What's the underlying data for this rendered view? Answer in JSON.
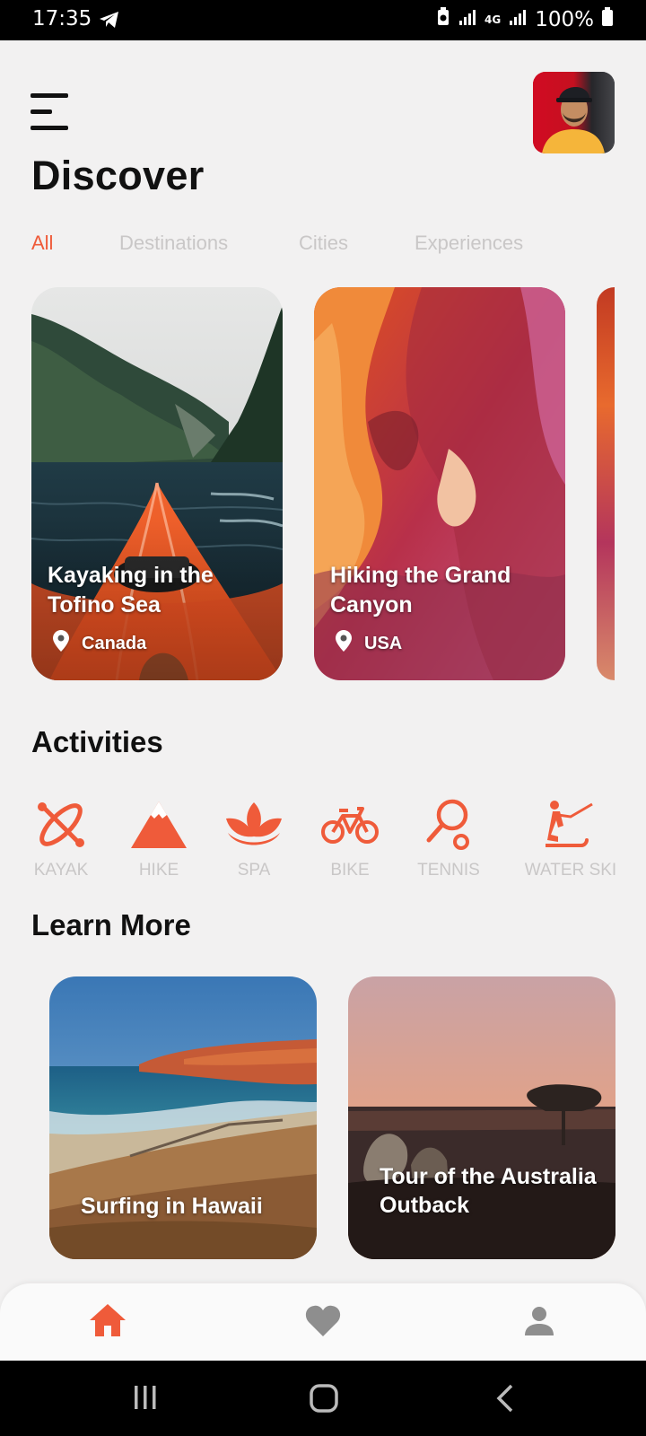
{
  "status_bar": {
    "time": "17:35",
    "battery": "100%",
    "network": "4G"
  },
  "header": {
    "title": "Discover"
  },
  "tabs": [
    {
      "label": "All",
      "active": true
    },
    {
      "label": "Destinations",
      "active": false
    },
    {
      "label": "Cities",
      "active": false
    },
    {
      "label": "Experiences",
      "active": false
    }
  ],
  "destinations": [
    {
      "title": "Kayaking in the Tofino Sea",
      "location": "Canada"
    },
    {
      "title": "Hiking the Grand Canyon",
      "location": "USA"
    }
  ],
  "activities_section": {
    "title": "Activities",
    "items": [
      {
        "label": "KAYAK",
        "icon": "kayak-icon"
      },
      {
        "label": "HIKE",
        "icon": "mountain-icon"
      },
      {
        "label": "SPA",
        "icon": "lotus-icon"
      },
      {
        "label": "BIKE",
        "icon": "bike-icon"
      },
      {
        "label": "TENNIS",
        "icon": "tennis-icon"
      },
      {
        "label": "WATER SKI",
        "icon": "water-ski-icon"
      }
    ]
  },
  "learn_more": {
    "title": "Learn More",
    "items": [
      {
        "title": "Surfing in Hawaii"
      },
      {
        "title": "Tour of the Australia Outback"
      }
    ]
  },
  "bottom_nav": {
    "items": [
      {
        "icon": "home-icon",
        "active": true
      },
      {
        "icon": "heart-icon",
        "active": false
      },
      {
        "icon": "person-icon",
        "active": false
      }
    ]
  },
  "colors": {
    "accent": "#ef5b3a",
    "inactive_text": "#c9c7c7",
    "background": "#f2f1f1",
    "nav_inactive": "#8e8e8e"
  }
}
